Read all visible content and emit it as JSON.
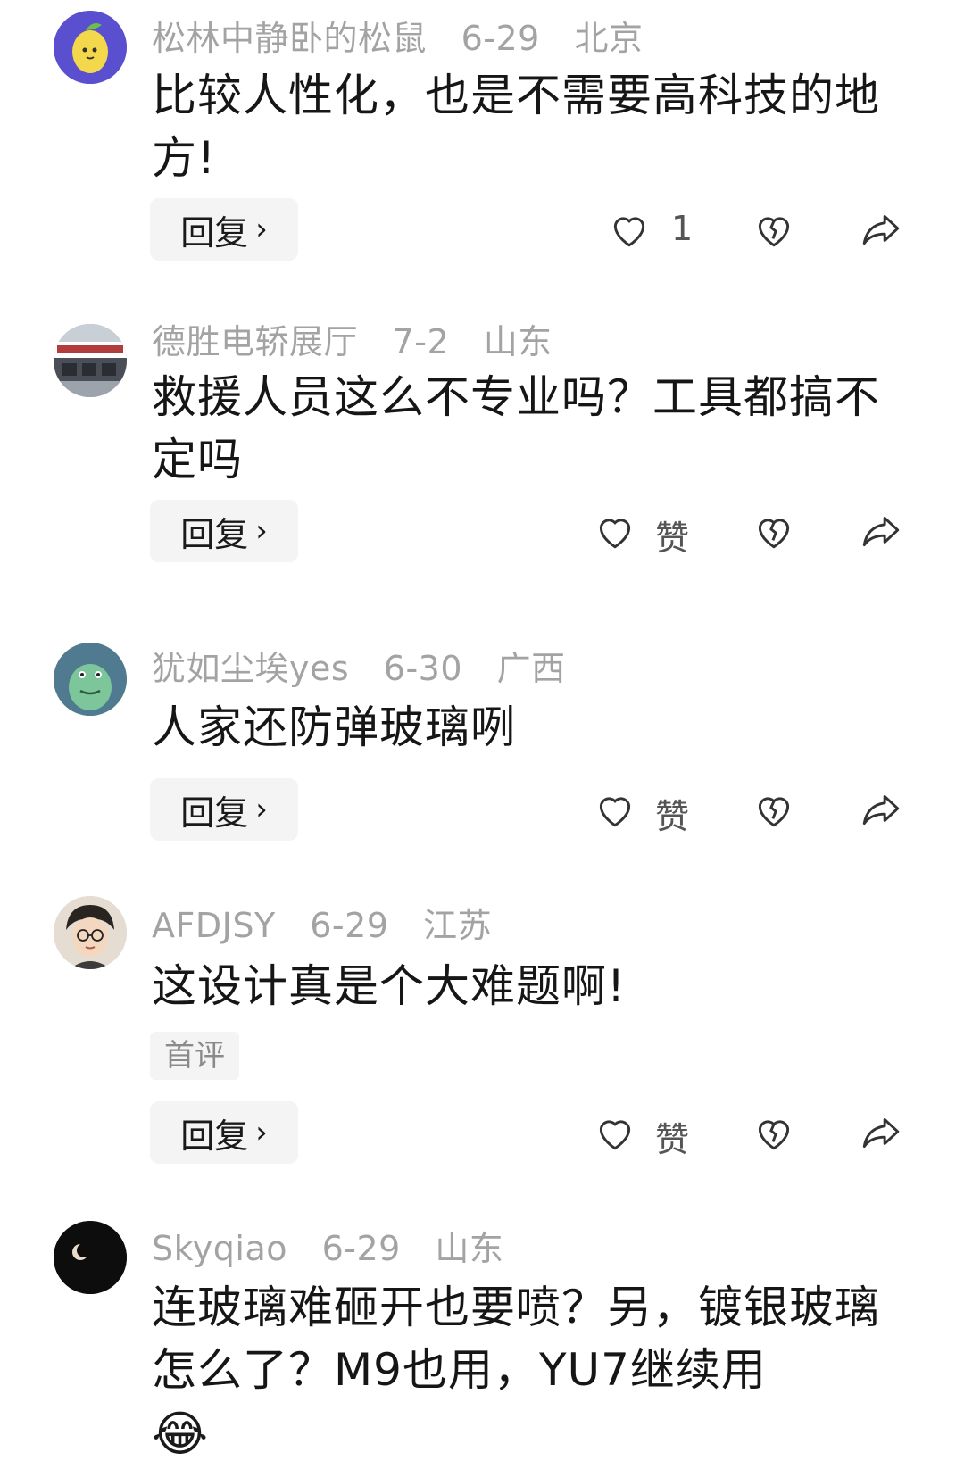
{
  "comments": [
    {
      "username": "松林中静卧的松鼠",
      "date": "6-29",
      "location": "北京",
      "text": "比较人性化，也是不需要高科技的地方!",
      "reply_label": "回复",
      "like_count": "1",
      "avatar_color": "#5a4fcf"
    },
    {
      "username": "德胜电轿展厅",
      "date": "7-2",
      "location": "山东",
      "text": "救援人员这么不专业吗？工具都搞不定吗",
      "reply_label": "回复",
      "like_count": "赞",
      "avatar_color": "#8a8f96"
    },
    {
      "username": "犹如尘埃yes",
      "date": "6-30",
      "location": "广西",
      "text": "人家还防弹玻璃咧",
      "reply_label": "回复",
      "like_count": "赞",
      "avatar_color": "#5e8f73"
    },
    {
      "username": "AFDJSY",
      "date": "6-29",
      "location": "江苏",
      "text": "这设计真是个大难题啊!",
      "tag": "首评",
      "reply_label": "回复",
      "like_count": "赞",
      "avatar_color": "#d9cfc2"
    },
    {
      "username": "Skyqiao",
      "date": "6-29",
      "location": "山东",
      "text": "连玻璃难砸开也要喷？另，镀银玻璃怎么了？M9也用，YU7继续用",
      "emoji": "😂",
      "avatar_color": "#111111"
    }
  ]
}
